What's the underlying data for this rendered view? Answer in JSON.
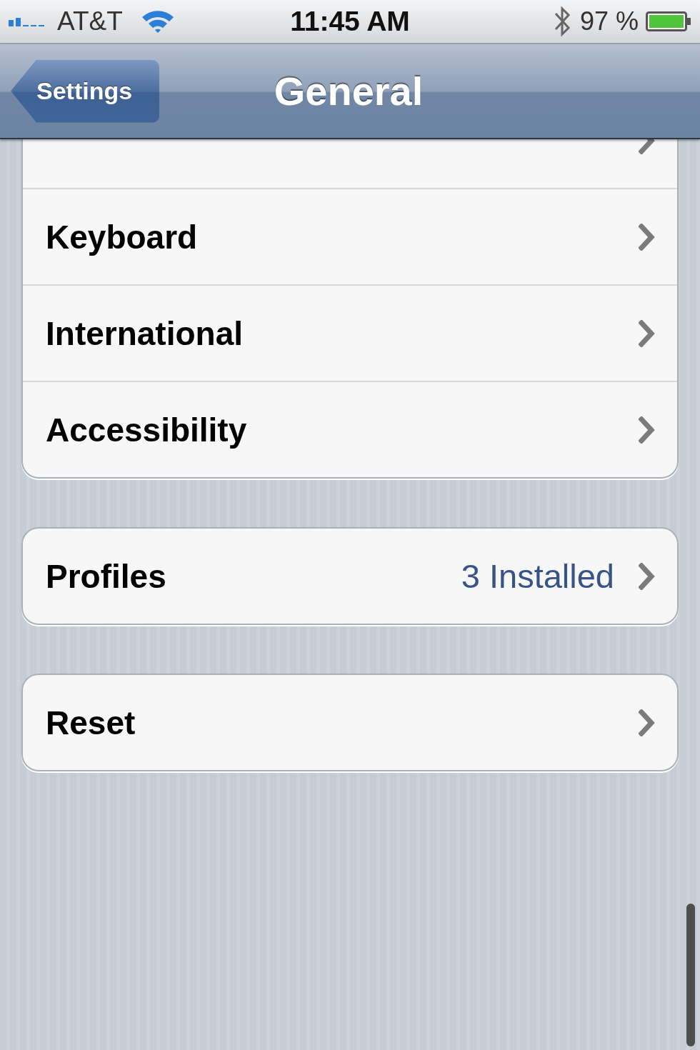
{
  "status_bar": {
    "carrier": "AT&T",
    "time": "11:45 AM",
    "battery": "97 %"
  },
  "nav_bar": {
    "back_button": "Settings",
    "title": "General"
  },
  "groups": [
    {
      "rows": [
        {},
        {
          "label": "Keyboard"
        },
        {
          "label": "International"
        },
        {
          "label": "Accessibility"
        }
      ]
    },
    {
      "rows": [
        {
          "label": "Profiles",
          "value": "3 Installed"
        }
      ]
    },
    {
      "rows": [
        {
          "label": "Reset"
        }
      ]
    }
  ]
}
